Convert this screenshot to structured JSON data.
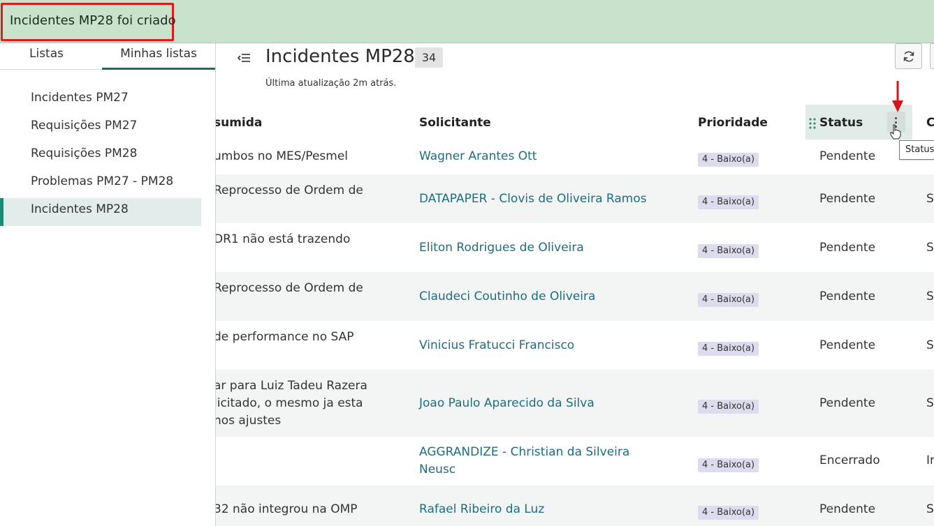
{
  "banner": {
    "message": "Incidentes MP28 foi criado"
  },
  "sidebar": {
    "tabs": [
      {
        "label": "Listas"
      },
      {
        "label": "Minhas listas"
      }
    ],
    "items": [
      {
        "label": "Incidentes PM27"
      },
      {
        "label": "Requisições PM27"
      },
      {
        "label": "Requisições PM28"
      },
      {
        "label": "Problemas PM27 - PM28"
      },
      {
        "label": "Incidentes MP28"
      }
    ]
  },
  "header": {
    "title": "Incidentes MP28",
    "count": "34",
    "updated": "Última atualização 2m atrás."
  },
  "table": {
    "columns": {
      "desc": "sumida",
      "requester": "Solicitante",
      "priority": "Prioridade",
      "status": "Status",
      "last": "C"
    },
    "rows": [
      {
        "desc": "umbos no MES/Pesmel",
        "requester": "Wagner Arantes Ott",
        "priority": "4 - Baixo(a)",
        "status": "Pendente",
        "last": ""
      },
      {
        "desc": "Reprocesso de Ordem de",
        "requester": "DATAPAPER - Clovis de Oliveira Ramos",
        "priority": "4 - Baixo(a)",
        "status": "Pendente",
        "last": "S"
      },
      {
        "desc": "DR1 não está trazendo",
        "requester": "Eliton Rodrigues de Oliveira",
        "priority": "4 - Baixo(a)",
        "status": "Pendente",
        "last": "S"
      },
      {
        "desc": "Reprocesso de Ordem de",
        "requester": "Claudeci Coutinho de Oliveira",
        "priority": "4 - Baixo(a)",
        "status": "Pendente",
        "last": "S"
      },
      {
        "desc": "de performance no SAP",
        "requester": "Vinicius Fratucci Francisco",
        "priority": "4 - Baixo(a)",
        "status": "Pendente",
        "last": "S"
      },
      {
        "desc": "ar para Luiz Tadeu Razera\nlicitado, o mesmo ja esta\nnos ajustes",
        "requester": "Joao Paulo Aparecido da Silva",
        "priority": "4 - Baixo(a)",
        "status": "Pendente",
        "last": "S"
      },
      {
        "desc": "",
        "requester": "AGGRANDIZE - Christian da Silveira\nNeusc",
        "priority": "4 - Baixo(a)",
        "status": "Encerrado",
        "last": "Ir"
      },
      {
        "desc": "32 não integrou na OMP",
        "requester": "Rafael Ribeiro da Luz",
        "priority": "4 - Baixo(a)",
        "status": "Pendente",
        "last": "S"
      }
    ]
  },
  "tooltip": {
    "text": "Status"
  },
  "icons": {
    "collapse": "collapse-sidebar-icon",
    "refresh": "refresh-icon",
    "kebab": "more-vertical-icon",
    "grip": "drag-handle-icon",
    "cursor": "hand-pointer-icon",
    "arrow": "annotation-arrow-icon"
  },
  "colors": {
    "banner_bg": "#c8e2cb",
    "highlight_border": "#e01b1b",
    "link": "#1d6d80",
    "active_item_bg": "#e2ecea",
    "active_accent": "#1f8a72"
  }
}
